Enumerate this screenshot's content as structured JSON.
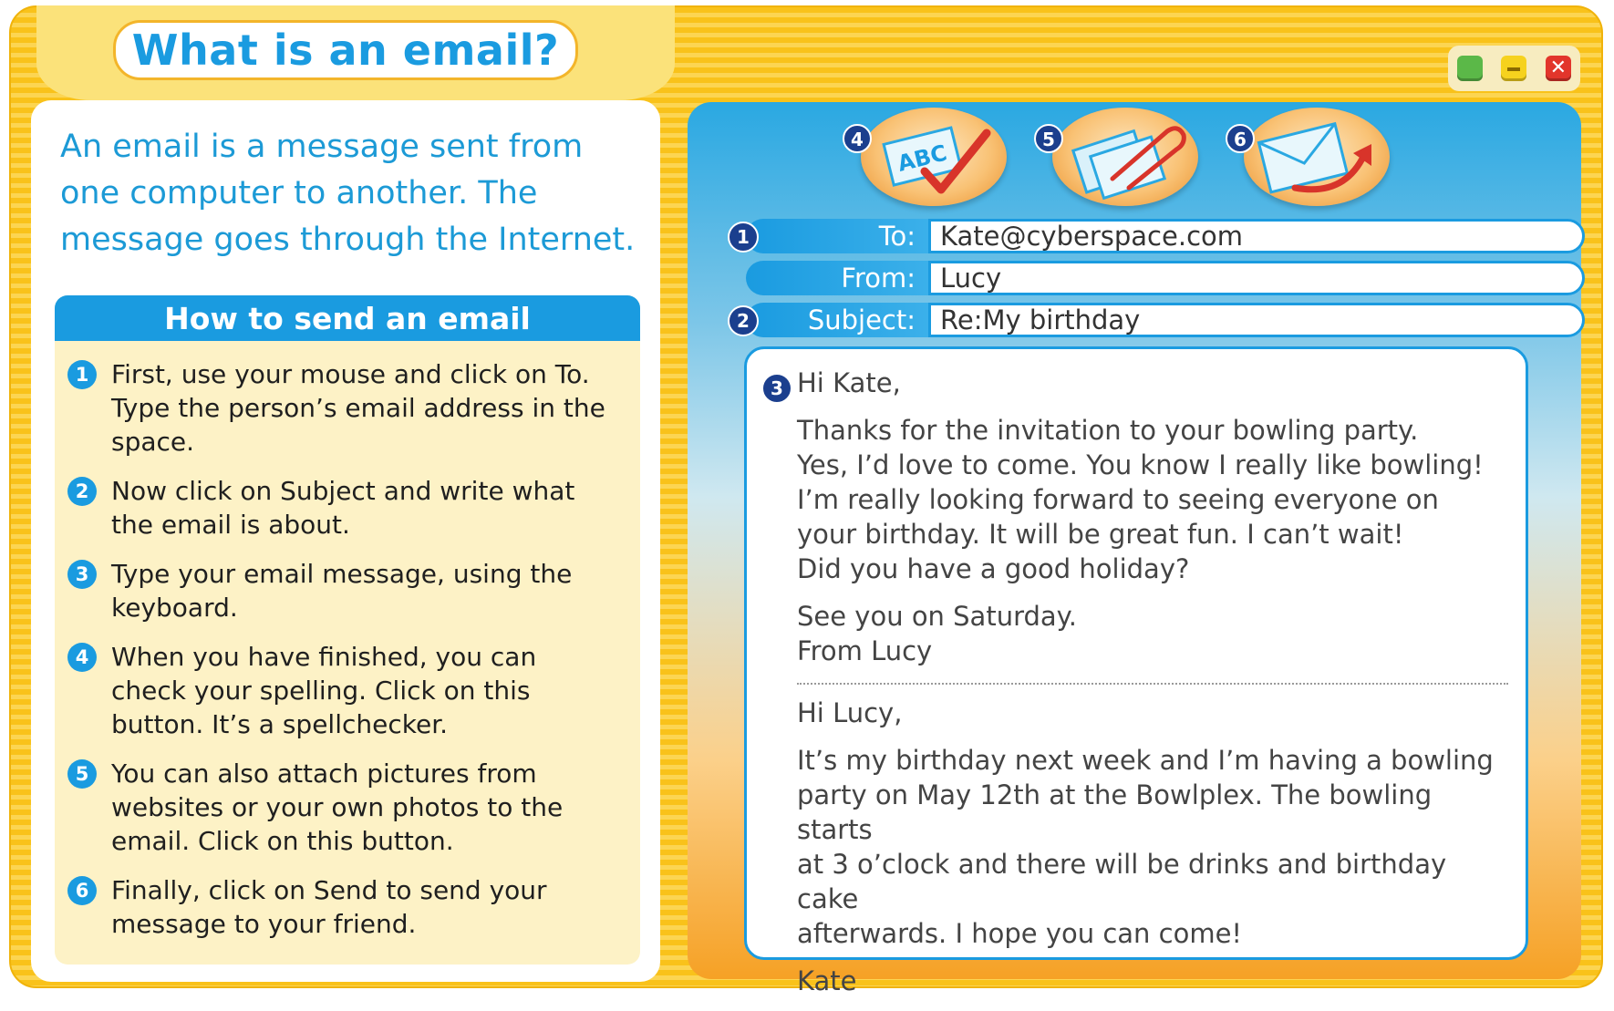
{
  "title": "What is an email?",
  "intro": "An email is a message sent from one computer to another. The message goes through the Internet.",
  "how_to": {
    "heading": "How to send an email",
    "steps": [
      {
        "num": "1",
        "text": "First, use your mouse and click on To. Type the person’s email address in the space."
      },
      {
        "num": "2",
        "text": "Now click on Subject and write what the email is about."
      },
      {
        "num": "3",
        "text": "Type your email message, using the keyboard."
      },
      {
        "num": "4",
        "text": "When you have finished, you can check your spelling. Click on this button. It’s a spellchecker."
      },
      {
        "num": "5",
        "text": "You can also attach pictures from websites or your own photos to the email. Click on this button."
      },
      {
        "num": "6",
        "text": "Finally, click on Send to send your message to your friend."
      }
    ]
  },
  "window_controls": {
    "close_symbol": "✕"
  },
  "toolbar": [
    {
      "num": "4",
      "icon": "spellcheck-icon",
      "label": "ABC"
    },
    {
      "num": "5",
      "icon": "attach-icon"
    },
    {
      "num": "6",
      "icon": "send-icon"
    }
  ],
  "email": {
    "to": {
      "num": "1",
      "label": "To:",
      "value": "Kate@cyberspace.com"
    },
    "from": {
      "label": "From:",
      "value": "Lucy"
    },
    "subject": {
      "num": "2",
      "label": "Subject:",
      "value": "Re:My birthday"
    },
    "body_num": "3",
    "reply": {
      "greeting": "Hi Kate,",
      "paragraph": "Thanks for the invitation to your bowling party.\nYes, I’d love to come. You know I really like bowling!\nI’m really looking forward to seeing everyone on\nyour birthday. It will be great fun. I can’t wait!\nDid you have a good holiday?",
      "closing": "See you on Saturday.\nFrom Lucy"
    },
    "original": {
      "greeting": "Hi Lucy,",
      "paragraph": "It’s my birthday next week and I’m having a bowling\nparty on May 12th at the Bowlplex. The bowling starts\nat 3 o’clock and there will be drinks and birthday cake\nafterwards. I hope you can come!",
      "signature": "Kate"
    }
  }
}
